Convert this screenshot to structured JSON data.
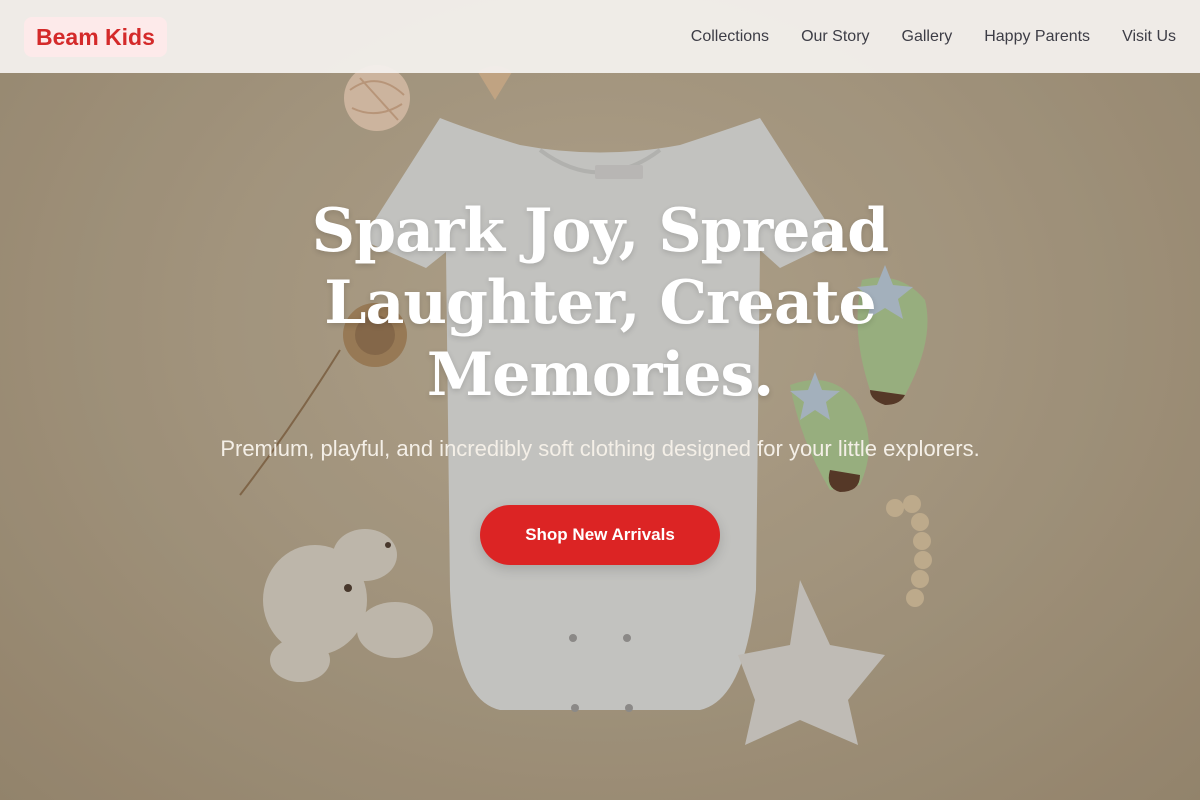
{
  "nav": {
    "logo": "Beam Kids",
    "links": [
      "Collections",
      "Our Story",
      "Gallery",
      "Happy Parents",
      "Visit Us"
    ]
  },
  "hero": {
    "title": "Spark Joy, Spread Laughter, Create Memories.",
    "subtitle": "Premium, playful, and incredibly soft clothing designed for your little explorers.",
    "cta_label": "Shop New Arrivals"
  },
  "colors": {
    "brand_red": "#dc2424",
    "logo_bg": "#fdeaea",
    "nav_bg": "#f3f0ed"
  }
}
